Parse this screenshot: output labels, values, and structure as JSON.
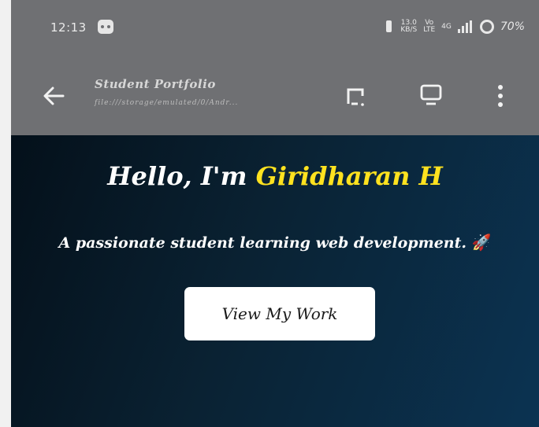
{
  "status_bar": {
    "time": "12:13",
    "network_top": "13.0",
    "network_bottom": "KB/S",
    "volte_top": "Vo",
    "volte_bottom": "LTE",
    "signal_label": "4G",
    "battery": "70%"
  },
  "browser": {
    "page_title": "Student Portfolio",
    "url": "file:///storage/emulated/0/Andr..."
  },
  "hero": {
    "greeting": "Hello, I'm",
    "name": "Giridharan H",
    "subtitle": "A passionate student learning web development.",
    "emoji": "🚀",
    "cta_label": "View My Work"
  },
  "colors": {
    "bar_bg": "#6f7073",
    "hero_gradient_start": "#04101a",
    "hero_gradient_end": "#0b3352",
    "name_accent": "#ffe21f"
  },
  "icons": [
    "app-notification-icon",
    "vibrate-icon",
    "signal-icon",
    "battery-icon",
    "back-arrow-icon",
    "cast-icon",
    "monitor-icon",
    "more-vert-icon"
  ]
}
